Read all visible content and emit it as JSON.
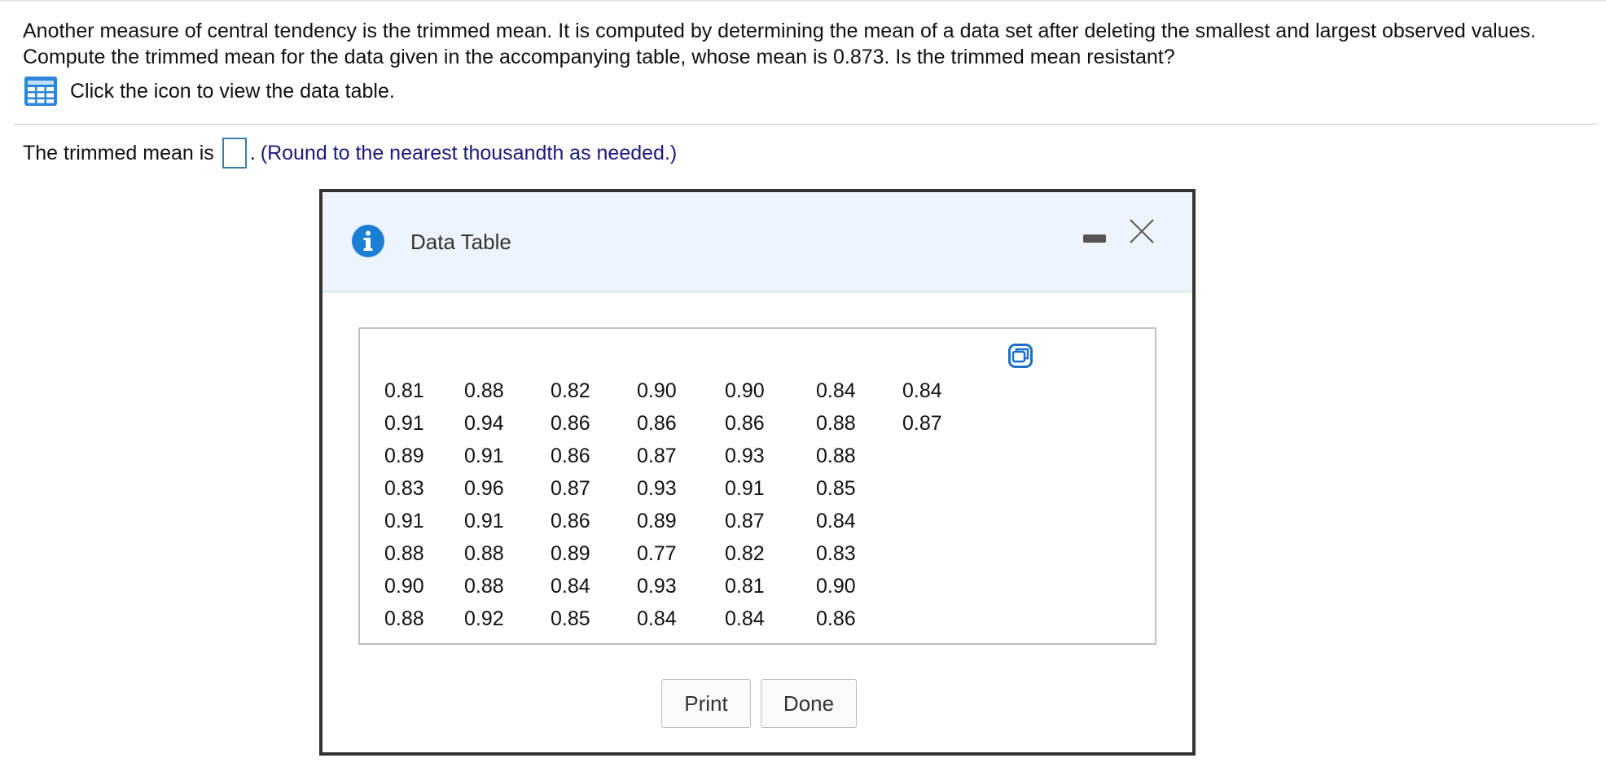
{
  "question": {
    "text": "Another measure of central tendency is the trimmed mean. It is computed by determining the mean of a data set after deleting the smallest and largest observed values. Compute the trimmed mean for the data given in the accompanying table, whose mean is 0.873. Is the trimmed mean resistant?",
    "table_link_label": "Click the icon to view the data table."
  },
  "answer": {
    "prefix": "The trimmed mean is",
    "value": "",
    "suffix": ".",
    "hint": "(Round to the nearest thousandth as needed.)"
  },
  "modal": {
    "title": "Data Table",
    "rows": [
      [
        "0.81",
        "0.88",
        "0.82",
        "0.90",
        "0.90",
        "0.84",
        "0.84"
      ],
      [
        "0.91",
        "0.94",
        "0.86",
        "0.86",
        "0.86",
        "0.88",
        "0.87"
      ],
      [
        "0.89",
        "0.91",
        "0.86",
        "0.87",
        "0.93",
        "0.88",
        ""
      ],
      [
        "0.83",
        "0.96",
        "0.87",
        "0.93",
        "0.91",
        "0.85",
        ""
      ],
      [
        "0.91",
        "0.91",
        "0.86",
        "0.89",
        "0.87",
        "0.84",
        ""
      ],
      [
        "0.88",
        "0.88",
        "0.89",
        "0.77",
        "0.82",
        "0.83",
        ""
      ],
      [
        "0.90",
        "0.88",
        "0.84",
        "0.93",
        "0.81",
        "0.90",
        ""
      ],
      [
        "0.88",
        "0.92",
        "0.85",
        "0.84",
        "0.84",
        "0.86",
        ""
      ]
    ],
    "print_label": "Print",
    "done_label": "Done"
  },
  "colors": {
    "accent": "#1b7fd6",
    "hint_text": "#1a1a80",
    "header_bg": "#eef4fb"
  },
  "icons": {
    "table_icon": "grid-table-icon",
    "info_icon": "info-icon",
    "minimize_icon": "minimize-icon",
    "close_icon": "close-icon",
    "copy_icon": "copy-icon"
  }
}
